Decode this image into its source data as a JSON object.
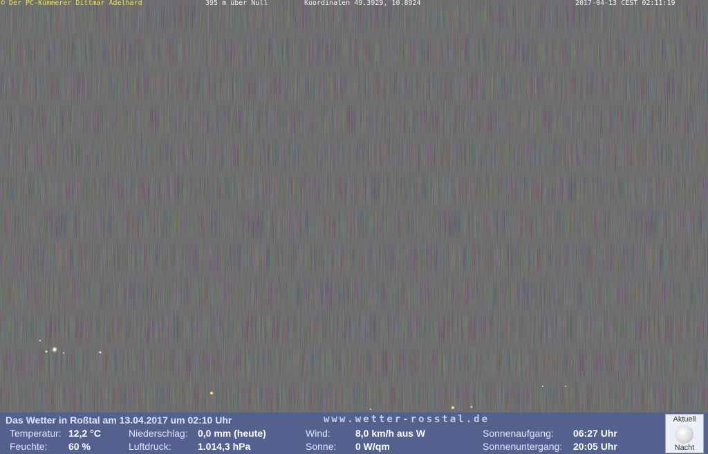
{
  "overlay": {
    "copyright": "© Der PC-Kümmerer Dittmar Adelhard",
    "altitude": "395 m über Null",
    "coordinates": "Koordinaten 49.3929, 10.8924",
    "timestamp": "2017-04-13 CEST 02:11:19"
  },
  "weather": {
    "title": "Das Wetter in Roßtal am 13.04.2017 um 02:10 Uhr",
    "website": "www.wetter-rosstal.de",
    "temp_label": "Temperatur:",
    "temp_value": "12,2 °C",
    "humidity_label": "Feuchte:",
    "humidity_value": "60 %",
    "precip_label": "Niederschlag:",
    "precip_value": "0,0 mm (heute)",
    "pressure_label": "Luftdruck:",
    "pressure_value": "1.014,3 hPa",
    "wind_label": "Wind:",
    "wind_value": "8,0 km/h aus W",
    "sun_label": "Sonne:",
    "sun_value": "0 W/qm",
    "sunrise_label": "Sonnenaufgang:",
    "sunrise_value": "06:27 Uhr",
    "sunset_label": "Sonnenuntergang:",
    "sunset_value": "20:05 Uhr",
    "moon_caption_top": "Aktuell",
    "moon_caption_bottom": "Nacht"
  }
}
